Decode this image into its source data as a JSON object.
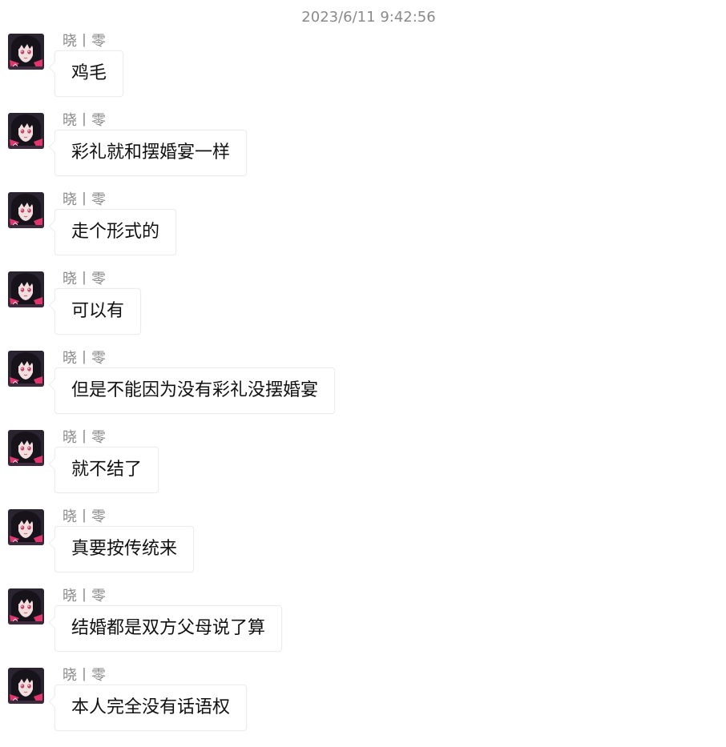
{
  "timestamp": "2023/6/11 9:42:56",
  "messages": [
    {
      "sender": "晓丨零",
      "text": "鸡毛",
      "avatar_icon": "anime-girl-avatar"
    },
    {
      "sender": "晓丨零",
      "text": "彩礼就和摆婚宴一样",
      "avatar_icon": "anime-girl-avatar"
    },
    {
      "sender": "晓丨零",
      "text": "走个形式的",
      "avatar_icon": "anime-girl-avatar"
    },
    {
      "sender": "晓丨零",
      "text": "可以有",
      "avatar_icon": "anime-girl-avatar"
    },
    {
      "sender": "晓丨零",
      "text": "但是不能因为没有彩礼没摆婚宴",
      "avatar_icon": "anime-girl-avatar"
    },
    {
      "sender": "晓丨零",
      "text": "就不结了",
      "avatar_icon": "anime-girl-avatar"
    },
    {
      "sender": "晓丨零",
      "text": "真要按传统来",
      "avatar_icon": "anime-girl-avatar"
    },
    {
      "sender": "晓丨零",
      "text": "结婚都是双方父母说了算",
      "avatar_icon": "anime-girl-avatar"
    },
    {
      "sender": "晓丨零",
      "text": "本人完全没有话语权",
      "avatar_icon": "anime-girl-avatar"
    }
  ],
  "colors": {
    "timestamp": "#8a8a8a",
    "sender": "#8a8a8a",
    "bubble_border": "#ececec",
    "message_text": "#111111",
    "background": "#ffffff"
  }
}
